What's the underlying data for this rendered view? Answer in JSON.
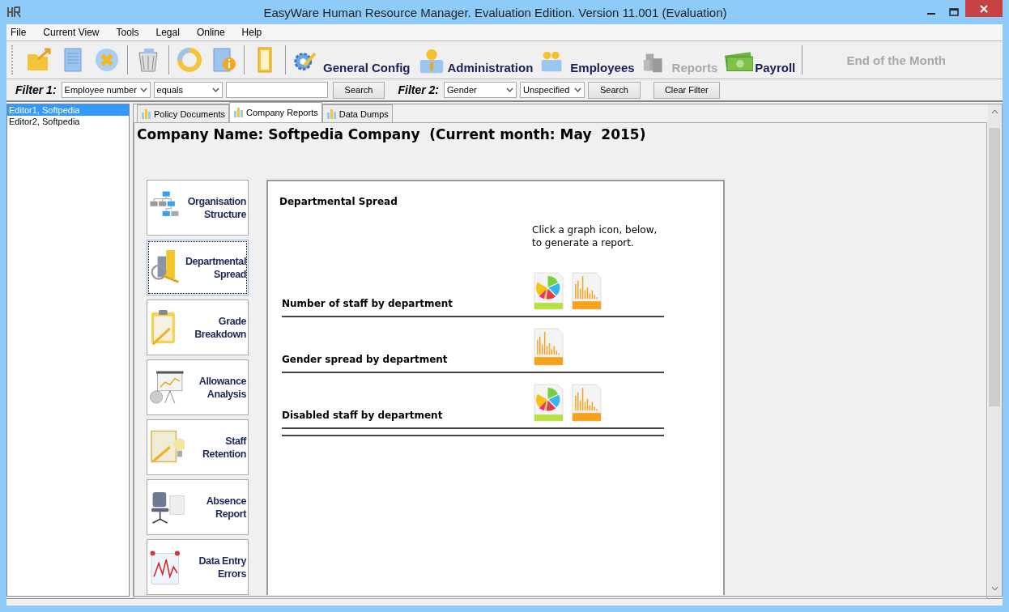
{
  "window": {
    "title": "EasyWare Human Resource Manager. Evaluation Edition. Version 11.001 (Evaluation)"
  },
  "menu": [
    "File",
    "Current View",
    "Tools",
    "Legal",
    "Online",
    "Help"
  ],
  "toolbar": {
    "buttons": [
      {
        "label": "General Config",
        "kind": "gear",
        "disabled": false
      },
      {
        "label": "Administration",
        "kind": "person",
        "disabled": false
      },
      {
        "label": "Employees",
        "kind": "people",
        "disabled": false
      },
      {
        "label": "Reports",
        "kind": "blocks",
        "disabled": true
      },
      {
        "label": "Payroll",
        "kind": "money",
        "disabled": false
      }
    ],
    "end_of_month": {
      "label": "End of the Month",
      "disabled": true
    }
  },
  "filters": [
    {
      "label": "Filter 1:",
      "field": "Employee number",
      "operator": "equals",
      "search": "Search"
    },
    {
      "label": "Filter 2:",
      "field": "Gender",
      "operator": "Unspecified",
      "search": "Search"
    }
  ],
  "clear_filter": "Clear Filter",
  "sidebar": {
    "items": [
      {
        "label": "Editor1, Softpedia",
        "selected": true
      },
      {
        "label": "Editor2, Softpedia",
        "selected": false
      }
    ]
  },
  "tabs": [
    {
      "label": "Policy Documents",
      "selected": false
    },
    {
      "label": "Company Reports",
      "selected": true
    },
    {
      "label": "Data Dumps",
      "selected": false
    }
  ],
  "heading": "Company Name: Softpedia Company  (Current month: May  2015)",
  "report_buttons": [
    {
      "lines": [
        "Organisation",
        "Structure"
      ],
      "kind": "org",
      "selected": false
    },
    {
      "lines": [
        "Departmental",
        "Spread"
      ],
      "kind": "spread",
      "selected": true
    },
    {
      "lines": [
        "Grade",
        "Breakdown"
      ],
      "kind": "clipboard",
      "selected": false
    },
    {
      "lines": [
        "Allowance",
        "Analysis"
      ],
      "kind": "presentation",
      "selected": false
    },
    {
      "lines": [
        "Staff",
        "Retention"
      ],
      "kind": "notebook",
      "selected": false
    },
    {
      "lines": [
        "Absence",
        "Report"
      ],
      "kind": "chair",
      "selected": false
    },
    {
      "lines": [
        "Data Entry",
        "Errors"
      ],
      "kind": "graph",
      "selected": false
    }
  ],
  "report_panel": {
    "title": "Departmental Spread",
    "hint": "Click a graph icon, below,\nto generate a report.",
    "reports": [
      {
        "label": "Number of staff by department",
        "icons": [
          {
            "kind": "pie"
          },
          {
            "kind": "bar"
          }
        ]
      },
      {
        "label": "Gender spread by department",
        "icons": [
          {
            "kind": "bar"
          }
        ]
      },
      {
        "label": "Disabled staff by department",
        "icons": [
          {
            "kind": "pie"
          },
          {
            "kind": "bar"
          }
        ]
      }
    ]
  }
}
